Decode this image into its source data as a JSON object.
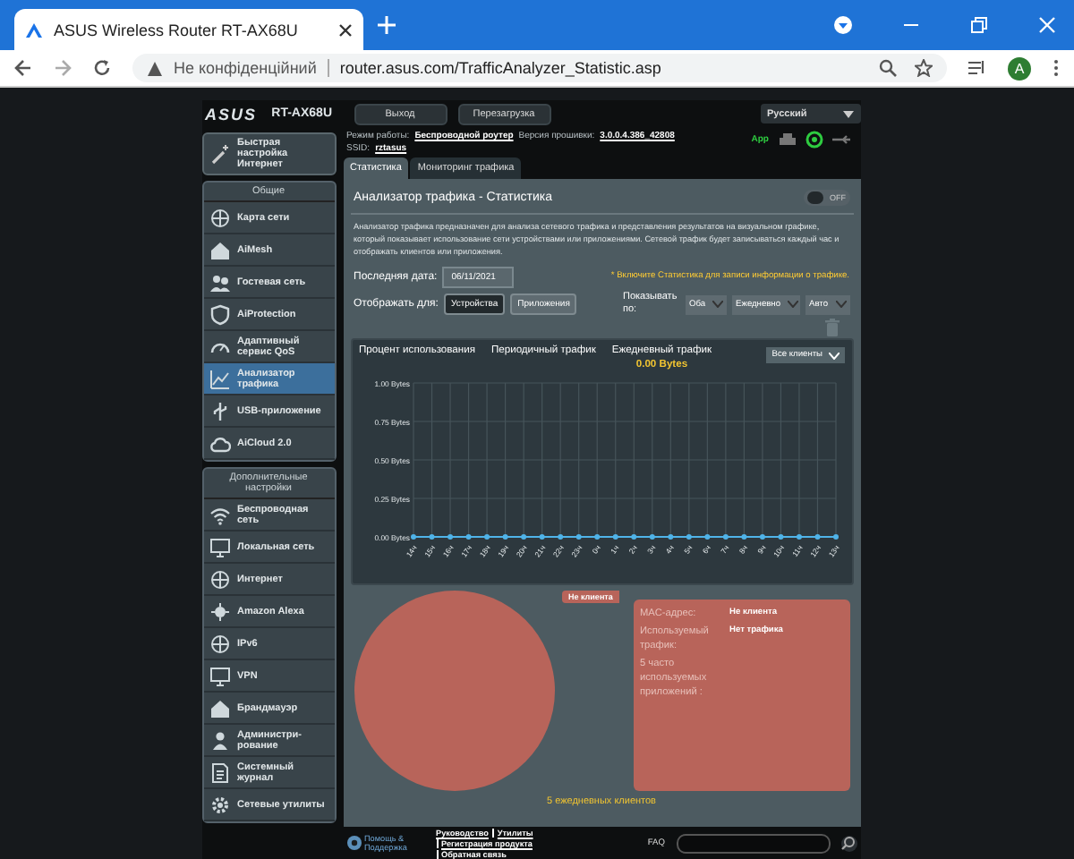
{
  "browser": {
    "tab_title": "ASUS Wireless Router RT-AX68U",
    "security": "Не конфіденційний",
    "url": "router.asus.com/TrafficAnalyzer_Statistic.asp",
    "avatar": "A"
  },
  "header": {
    "logo": "ASUS",
    "model": "RT-AX68U",
    "buttons": [
      "Выход",
      "Перезагрузка"
    ],
    "language": "Русский"
  },
  "info": {
    "mode_label": "Режим работы:",
    "mode": "Беспроводной роутер",
    "firmware_label": "Версия прошивки:",
    "firmware": "3.0.0.4.386_42808",
    "ssid_label": "SSID:",
    "ssid": "rztasus",
    "app": "App"
  },
  "sidebar": {
    "quick_setup": "Быстрая настройка Интернет",
    "sections": [
      {
        "title": "Общие",
        "items": [
          {
            "label": "Карта сети",
            "selected": false
          },
          {
            "label": "AiMesh",
            "selected": false
          },
          {
            "label": "Гостевая сеть",
            "selected": false
          },
          {
            "label": "AiProtection",
            "selected": false
          },
          {
            "label": "Адаптивный сервис QoS",
            "selected": false
          },
          {
            "label": "Анализатор трафика",
            "selected": true
          },
          {
            "label": "USB-приложение",
            "selected": false
          },
          {
            "label": "AiCloud 2.0",
            "selected": false
          }
        ]
      },
      {
        "title": "Дополнительные настройки",
        "items": [
          {
            "label": "Беспроводная сеть",
            "selected": false
          },
          {
            "label": "Локальная сеть",
            "selected": false
          },
          {
            "label": "Интернет",
            "selected": false
          },
          {
            "label": "Amazon Alexa",
            "selected": false
          },
          {
            "label": "IPv6",
            "selected": false
          },
          {
            "label": "VPN",
            "selected": false
          },
          {
            "label": "Брандмауэр",
            "selected": false
          },
          {
            "label": "Администри-рование",
            "selected": false
          },
          {
            "label": "Системный журнал",
            "selected": false
          },
          {
            "label": "Сетевые утилиты",
            "selected": false
          }
        ]
      }
    ]
  },
  "tabs": [
    {
      "label": "Статистика",
      "selected": true
    },
    {
      "label": "Мониторинг трафика",
      "selected": false
    }
  ],
  "panel": {
    "title": "Анализатор трафика - Статистика",
    "toggle": {
      "on": false,
      "label": "OFF"
    },
    "description": "Анализатор трафика предназначен для анализа сетевого трафика и представления результатов на визуальном графике, который показывает использование сети устройствами или приложениями. Сетевой трафик будет записываться каждый час и отображать клиентов или приложения.",
    "date_label": "Последняя дата:",
    "date": "06/11/2021",
    "notice": "* Включите Статистика для записи информации о трафике.",
    "display_label": "Отображать для:",
    "display_options": [
      {
        "label": "Устройства",
        "selected": true
      },
      {
        "label": "Приложения",
        "selected": false
      }
    ],
    "show_by_label": "Показывать по:",
    "selects": [
      "Оба",
      "Ежедневно",
      "Авто"
    ]
  },
  "chart_panel": {
    "headers": [
      "Процент использования",
      "Периодичный трафик",
      "Ежедневный трафик"
    ],
    "total": "0.00 Bytes",
    "client_select": "Все клиенты",
    "chart_data": {
      "type": "line",
      "grid": true,
      "categories": [
        "14ч",
        "15ч",
        "16ч",
        "17ч",
        "18ч",
        "19ч",
        "20ч",
        "21ч",
        "22ч",
        "23ч",
        "0ч",
        "1ч",
        "2ч",
        "3ч",
        "4ч",
        "5ч",
        "6ч",
        "7ч",
        "8ч",
        "9ч",
        "10ч",
        "11ч",
        "12ч",
        "13ч"
      ],
      "series": [
        {
          "color": "#4fb3e8",
          "marker": "circle",
          "values": [
            0,
            0,
            0,
            0,
            0,
            0,
            0,
            0,
            0,
            0,
            0,
            0,
            0,
            0,
            0,
            0,
            0,
            0,
            0,
            0,
            0,
            0,
            0,
            0
          ]
        }
      ],
      "ylim": [
        0,
        1
      ],
      "yticks": [
        {
          "value": 0,
          "label": "0.00 Bytes"
        },
        {
          "value": 0.25,
          "label": "0.25 Bytes"
        },
        {
          "value": 0.5,
          "label": "0.50 Bytes"
        },
        {
          "value": 0.75,
          "label": "0.75 Bytes"
        },
        {
          "value": 1,
          "label": "1.00 Bytes"
        }
      ]
    }
  },
  "clients": {
    "pie_label": "Не клиента",
    "details": [
      {
        "label": "MAC-адрес:",
        "value": "Не клиента"
      },
      {
        "label": "Используемый трафик:",
        "value": "Нет трафика"
      },
      {
        "label": "5 часто используемых приложений :"
      }
    ],
    "summary": "5 ежедневных клиентов"
  },
  "footer": {
    "help": "Помощь & Поддержка",
    "links": [
      "Руководство",
      "Утилиты",
      "Регистрация продукта",
      "Обратная связь"
    ],
    "faq": "FAQ"
  }
}
